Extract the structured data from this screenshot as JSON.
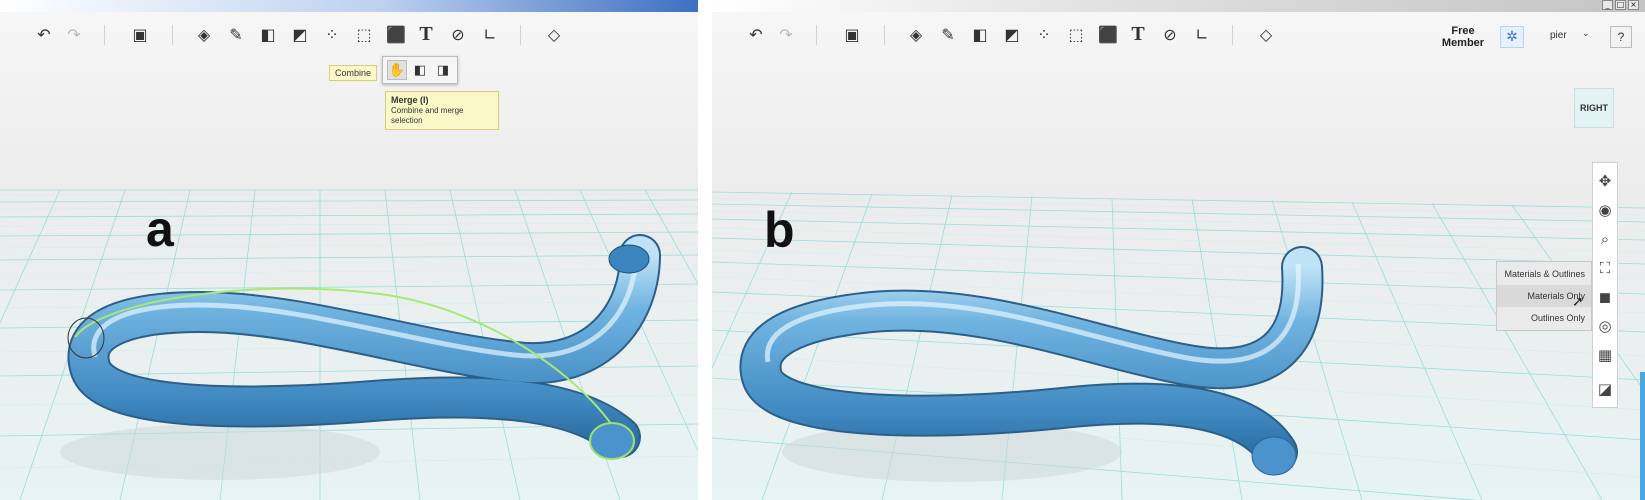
{
  "panel_a": {
    "label": "a",
    "toolbar_icons": [
      "undo-icon",
      "redo-icon",
      "add-object-icon",
      "primitives-icon",
      "sketch-icon",
      "construct-icon",
      "modify-icon",
      "pattern-icon",
      "group-icon",
      "combine-icon",
      "text-icon",
      "snap-icon",
      "measure-icon",
      "material-icon"
    ],
    "combine_tooltip": "Combine",
    "merge_tooltip": {
      "title": "Merge (I)",
      "description": "Combine and merge selection"
    }
  },
  "panel_b": {
    "label": "b",
    "toolbar_icons": [
      "undo-icon",
      "redo-icon",
      "add-object-icon",
      "primitives-icon",
      "sketch-icon",
      "construct-icon",
      "modify-icon",
      "pattern-icon",
      "group-icon",
      "combine-icon",
      "text-icon",
      "snap-icon",
      "measure-icon",
      "material-icon"
    ],
    "member_label_line1": "Free",
    "member_label_line2": "Member",
    "username": "pier",
    "help_label": "?",
    "view_cube_label": "RIGHT",
    "visual_style_menu": [
      "Materials & Outlines",
      "Materials Only",
      "Outlines Only"
    ],
    "navigation_icons": [
      "pan-icon",
      "orbit-icon",
      "zoom-icon",
      "fit-icon",
      "visual-style-icon",
      "visibility-icon",
      "grid-icon",
      "material-render-icon"
    ],
    "window_buttons": [
      "_",
      "□",
      "×"
    ]
  },
  "colors": {
    "tube": "#4a9bd0",
    "tube_highlight": "#cde6f7",
    "selection_outline": "#9fe06a",
    "grid_line": "#92dbdb",
    "title_strip_a": "#3d6fc2",
    "title_strip_b": "#d8d8d8"
  }
}
